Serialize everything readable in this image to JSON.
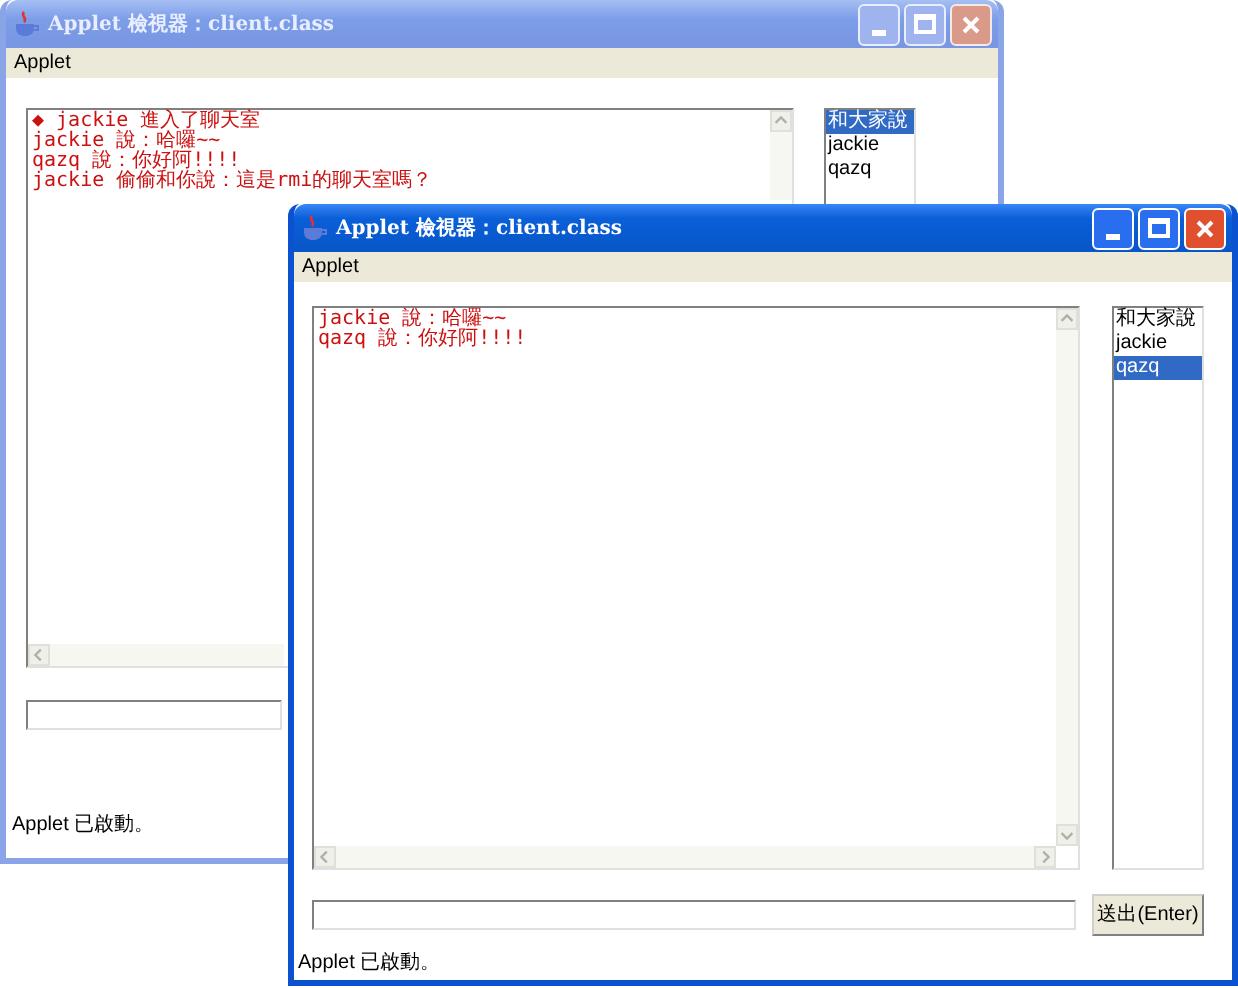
{
  "windows": [
    {
      "title": "Applet 檢視器：client.class",
      "active": false,
      "menu": [
        "Applet"
      ],
      "chat_lines": [
        "◆ jackie 進入了聊天室",
        "jackie 說：哈囉~~",
        "qazq 說：你好阿!!!!",
        "jackie 偷偷和你說：這是rmi的聊天室嗎？"
      ],
      "users": [
        {
          "label": "和大家說",
          "selected": true
        },
        {
          "label": "jackie",
          "selected": false
        },
        {
          "label": "qazq",
          "selected": false
        }
      ],
      "status": "Applet 已啟動。"
    },
    {
      "title": "Applet 檢視器：client.class",
      "active": true,
      "menu": [
        "Applet"
      ],
      "chat_lines": [
        "jackie 說：哈囉~~",
        "qazq 說：你好阿!!!!"
      ],
      "users": [
        {
          "label": "和大家說",
          "selected": false
        },
        {
          "label": "jackie",
          "selected": false
        },
        {
          "label": "qazq",
          "selected": true
        }
      ],
      "send_button": "送出(Enter)",
      "status": "Applet 已啟動。"
    }
  ]
}
